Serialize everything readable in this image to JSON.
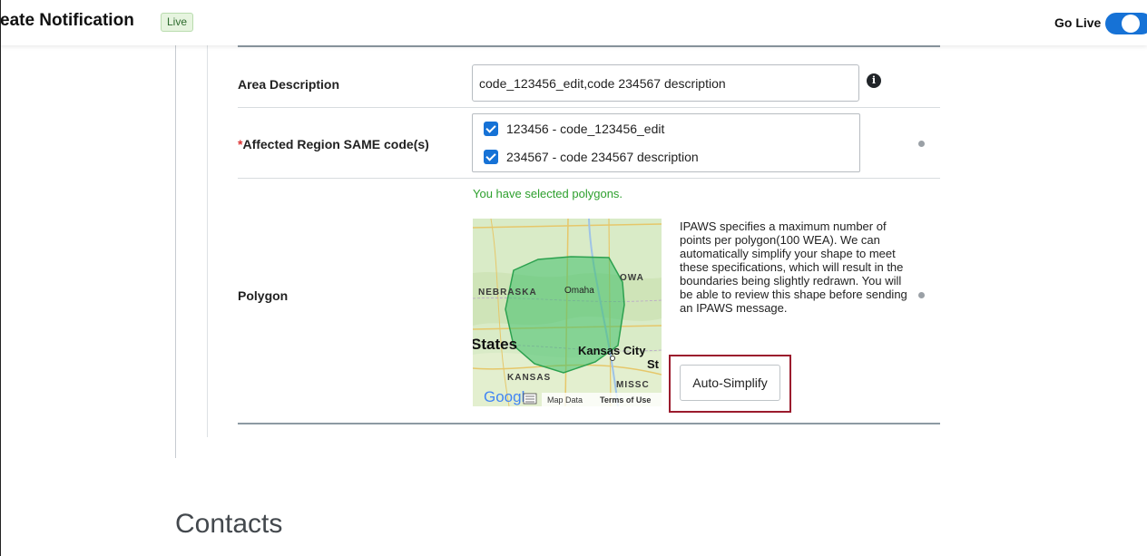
{
  "header": {
    "title": "eate Notification",
    "status_badge": "Live",
    "go_live_label": "Go Live",
    "go_live_on": true
  },
  "form": {
    "area_description": {
      "label": "Area Description",
      "value": "code_123456_edit,code 234567 description"
    },
    "affected_region": {
      "required_mark": "*",
      "label": "Affected Region SAME code(s)",
      "options": [
        {
          "text": "123456 - code_123456_edit",
          "checked": true
        },
        {
          "text": "234567 - code 234567 description",
          "checked": true
        }
      ]
    },
    "polygon": {
      "label": "Polygon",
      "selected_message": "You have selected polygons.",
      "description": "IPAWS specifies a maximum number of points per polygon(100 WEA). We can automatically simplify your shape to meet these specifications, which will result in the boundaries being slightly redrawn. You will be able to review this shape before sending an IPAWS message.",
      "auto_simplify_label": "Auto-Simplify",
      "map": {
        "labels": [
          "NEBRASKA",
          "Omaha",
          "OWA",
          "States",
          "Kansas City",
          "St",
          "KANSAS",
          "MISSC"
        ],
        "google_logo": "Google",
        "map_data": "Map Data",
        "terms": "Terms of Use"
      }
    }
  },
  "contacts": {
    "heading": "Contacts"
  },
  "colors": {
    "accent": "#1672d6",
    "success": "#2ea02e",
    "focus_outline": "#9b1b2d",
    "polygon_fill": "#3fbf6a"
  }
}
